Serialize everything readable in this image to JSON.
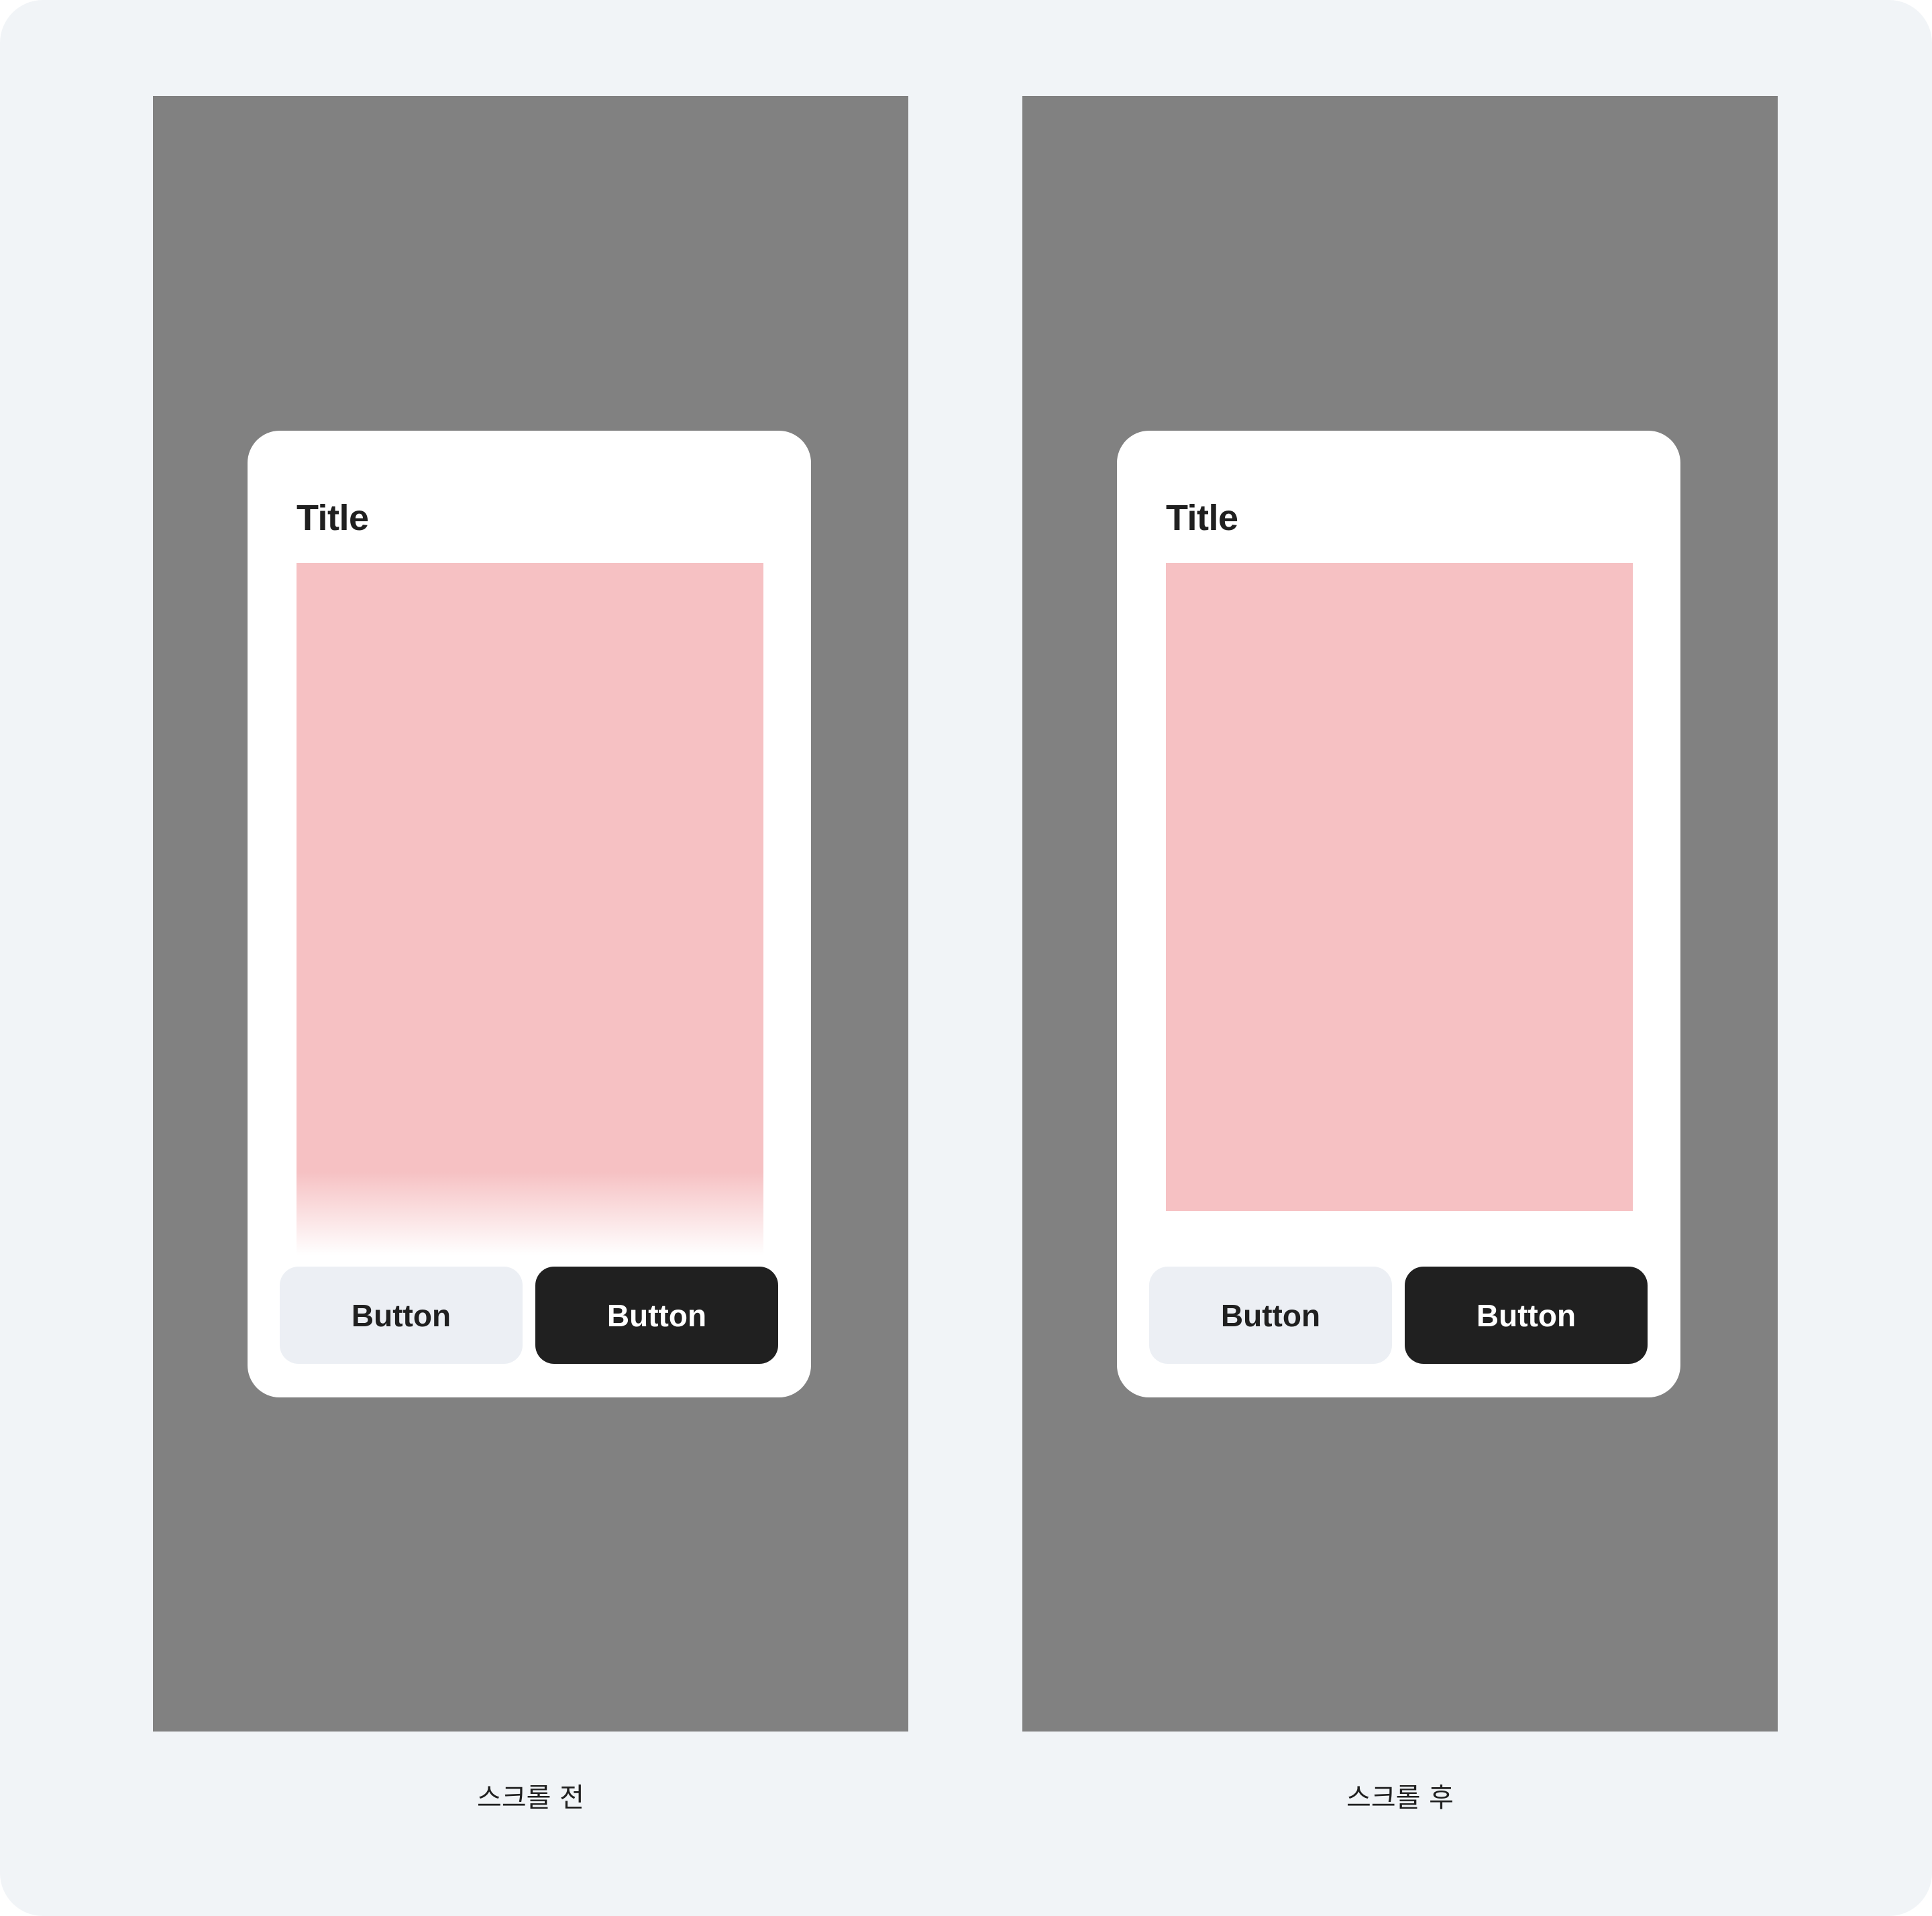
{
  "panels": [
    {
      "state": "before",
      "dialog": {
        "title": "Title",
        "secondary_button_label": "Button",
        "primary_button_label": "Button"
      },
      "caption": "스크롤 전"
    },
    {
      "state": "after",
      "dialog": {
        "title": "Title",
        "secondary_button_label": "Button",
        "primary_button_label": "Button"
      },
      "caption": "스크롤 후"
    }
  ],
  "colors": {
    "background": "#f1f4f7",
    "dim_overlay": "#818181",
    "dialog": "#ffffff",
    "content_placeholder": "#f6c1c3",
    "secondary_button": "#eceff4",
    "primary_button": "#202020",
    "text": "#202020"
  }
}
